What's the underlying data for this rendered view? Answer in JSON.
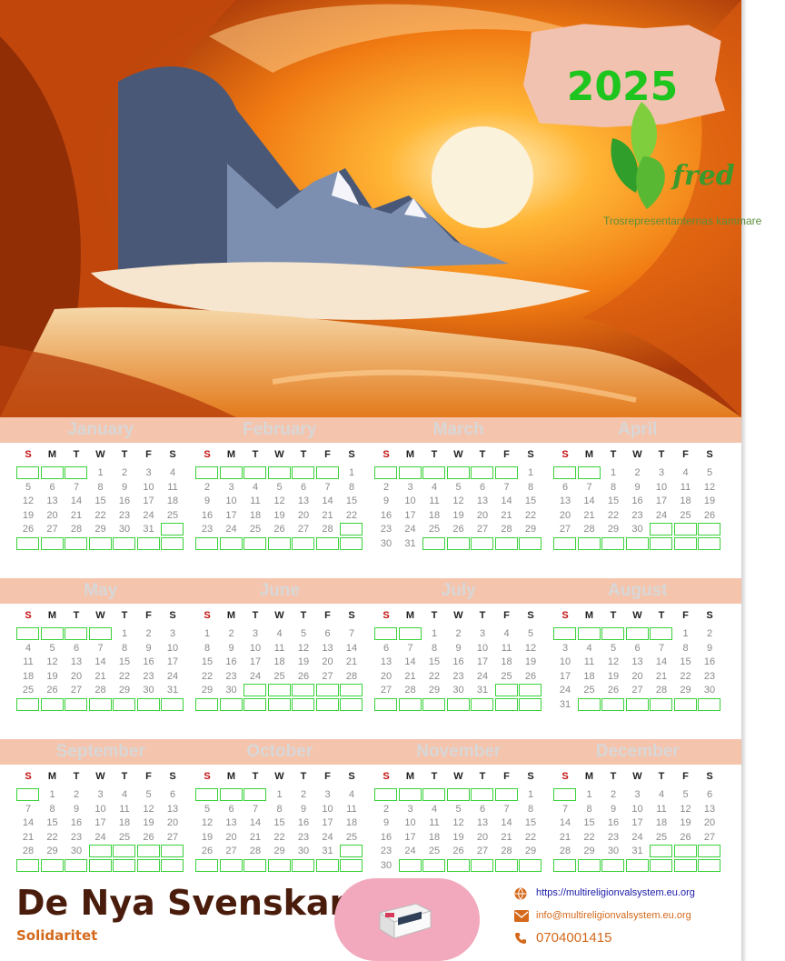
{
  "header": {
    "year": "2025",
    "logo_word": "fred",
    "tagline": "Trosrepresentanternas kammare"
  },
  "calendar": {
    "weekdays": [
      "S",
      "M",
      "T",
      "W",
      "T",
      "F",
      "S"
    ],
    "months": [
      {
        "name": "January",
        "offset": 3,
        "days": 31
      },
      {
        "name": "February",
        "offset": 6,
        "days": 28
      },
      {
        "name": "March",
        "offset": 6,
        "days": 31
      },
      {
        "name": "April",
        "offset": 2,
        "days": 30
      },
      {
        "name": "May",
        "offset": 4,
        "days": 31
      },
      {
        "name": "June",
        "offset": 0,
        "days": 30
      },
      {
        "name": "July",
        "offset": 2,
        "days": 31
      },
      {
        "name": "August",
        "offset": 5,
        "days": 31
      },
      {
        "name": "September",
        "offset": 1,
        "days": 30
      },
      {
        "name": "October",
        "offset": 3,
        "days": 31
      },
      {
        "name": "November",
        "offset": 6,
        "days": 30
      },
      {
        "name": "December",
        "offset": 1,
        "days": 31
      }
    ]
  },
  "footer": {
    "brand": "De Nya Svenskarna",
    "subtitle": "Solidaritet",
    "website": "https://multireligionvalsystem.eu.org",
    "email": "info@multireligionvalsystem.eu.org",
    "phone": "0704001415",
    "icons": [
      "globe-icon",
      "envelope-icon",
      "phone-icon"
    ]
  },
  "colors": {
    "band": "#f5c4ad",
    "sunday": "#c21010",
    "cell_border": "#3ad13a",
    "year": "#1ec51e",
    "brand": "#4a1c0c",
    "subtitle": "#d4691c",
    "contact": "#1a1aa8",
    "email": "#d4691c"
  }
}
